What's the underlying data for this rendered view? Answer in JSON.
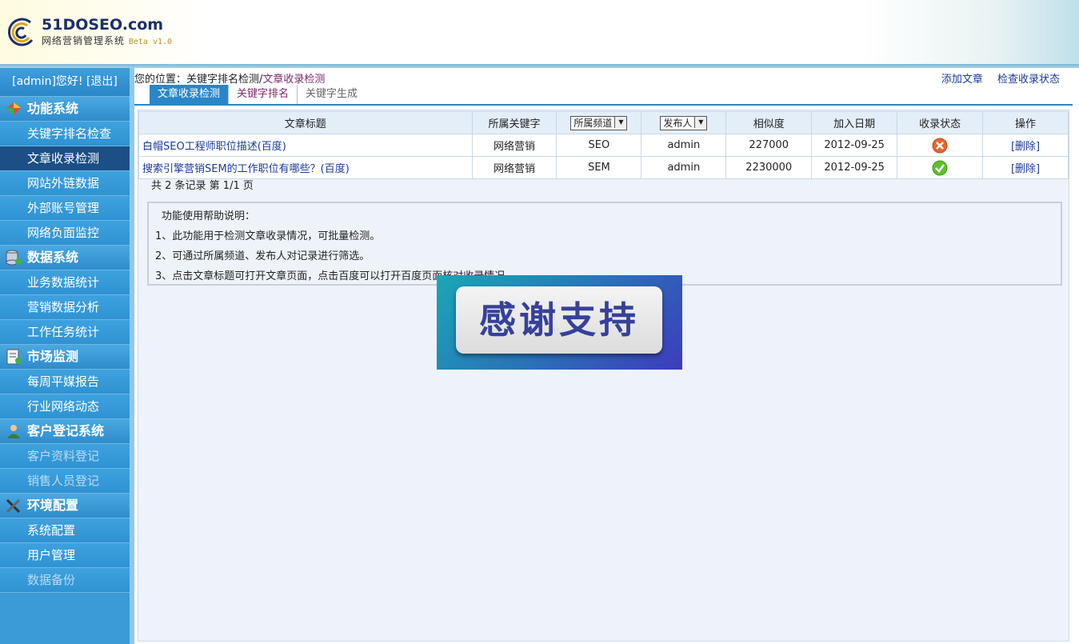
{
  "header": {
    "logo_title": "51DOSEO.com",
    "logo_sub": "网络营销管理系统",
    "logo_beta": "Beta v1.0"
  },
  "sidebar": {
    "user_text": "[admin]您好!  [退出]",
    "groups": [
      {
        "label": "功能系统",
        "icon": "diamond-icon",
        "items": [
          {
            "label": "关键字排名检查",
            "state": "normal"
          },
          {
            "label": "文章收录检测",
            "state": "active"
          },
          {
            "label": "网站外链数据",
            "state": "normal"
          },
          {
            "label": "外部账号管理",
            "state": "normal"
          },
          {
            "label": "网络负面监控",
            "state": "normal"
          }
        ]
      },
      {
        "label": "数据系统",
        "icon": "database-icon",
        "items": [
          {
            "label": "业务数据统计",
            "state": "normal"
          },
          {
            "label": "营销数据分析",
            "state": "normal"
          },
          {
            "label": "工作任务统计",
            "state": "normal"
          }
        ]
      },
      {
        "label": "市场监测",
        "icon": "report-icon",
        "items": [
          {
            "label": "每周平媒报告",
            "state": "normal"
          },
          {
            "label": "行业网络动态",
            "state": "normal"
          }
        ]
      },
      {
        "label": "客户登记系统",
        "icon": "user-icon",
        "items": [
          {
            "label": "客户资料登记",
            "state": "disabled"
          },
          {
            "label": "销售人员登记",
            "state": "disabled"
          }
        ]
      },
      {
        "label": "环境配置",
        "icon": "tools-icon",
        "items": [
          {
            "label": "系统配置",
            "state": "normal"
          },
          {
            "label": "用户管理",
            "state": "normal"
          },
          {
            "label": "数据备份",
            "state": "disabled"
          }
        ]
      }
    ]
  },
  "main": {
    "breadcrumb_prefix": "您的位置：关键字排名检测/",
    "breadcrumb_current": "文章收录检测",
    "top_links": {
      "add": "添加文章",
      "check": "检查收录状态"
    },
    "tabs": [
      "文章收录检测",
      "关键字排名",
      "关键字生成"
    ],
    "table": {
      "headers": {
        "title": "文章标题",
        "keyword": "所属关键字",
        "channel": "所属频道",
        "publisher": "发布人",
        "similarity": "相似度",
        "date": "加入日期",
        "status": "收录状态",
        "action": "操作"
      },
      "rows": [
        {
          "title": "白帽SEO工程师职位描述(百度)",
          "keyword": "网络营销",
          "channel": "SEO",
          "publisher": "admin",
          "similarity": "227000",
          "date": "2012-09-25",
          "status": "not-indexed",
          "action": "[删除]"
        },
        {
          "title": "搜索引擎营销SEM的工作职位有哪些？(百度)",
          "keyword": "网络营销",
          "channel": "SEM",
          "publisher": "admin",
          "similarity": "2230000",
          "date": "2012-09-25",
          "status": "indexed",
          "action": "[删除]"
        }
      ]
    },
    "summary": "共 2 条记录 第 1/1 页",
    "help": {
      "title": "功能使用帮助说明：",
      "lines": [
        "1、此功能用于检测文章收录情况，可批量检测。",
        "2、可通过所属频道、发布人对记录进行筛选。",
        "3、点击文章标题可打开文章页面，点击百度可以打开百度页面核对收录情况"
      ]
    },
    "overlay_text": "感谢支持"
  },
  "colors": {
    "sidebar_bg": "#3a9bd6",
    "sidebar_active": "#1b4f86",
    "link": "#1a3a9a",
    "tab_active": "#2a86c8",
    "status_bad": "#e8652a",
    "status_good": "#5fbf2e"
  }
}
